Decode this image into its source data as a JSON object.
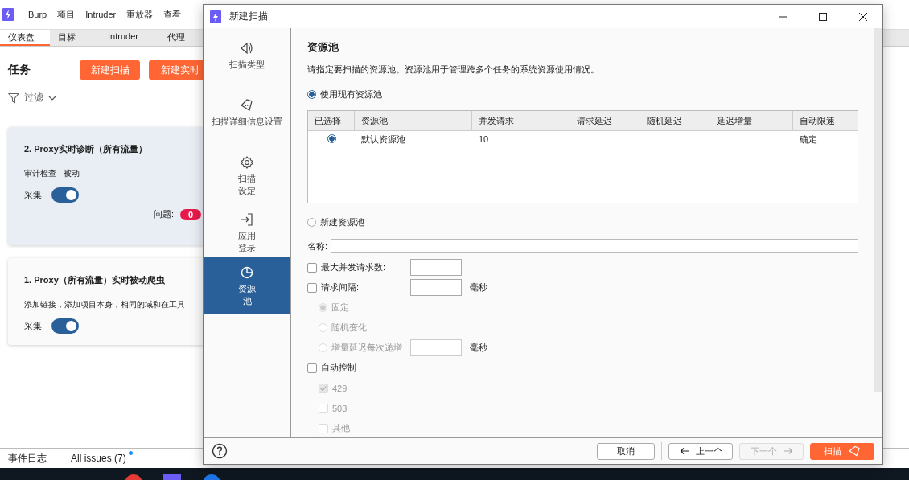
{
  "app": {
    "menu": [
      "Burp",
      "项目",
      "Intruder",
      "重放器",
      "查看"
    ],
    "tabs": [
      {
        "label": "仪表盘",
        "selected": true
      },
      {
        "label": "目标",
        "selected": false
      },
      {
        "label": "Intruder",
        "selected": false
      },
      {
        "label": "代理",
        "selected": false
      }
    ],
    "tasks_title": "任务",
    "task_buttons": [
      "新建扫描",
      "新建实时"
    ],
    "filter": "过滤",
    "tasks": [
      {
        "title": "2. Proxy实时诊断（所有流量）",
        "description": "审计检查 - 被动",
        "toggle_label": "采集",
        "on": true,
        "selected": true,
        "issues_label": "问题:",
        "issues": "0"
      },
      {
        "title": "1. Proxy（所有流量）实时被动爬虫",
        "description": "添加链接，添加项目本身，相同的域和在工具",
        "toggle_label": "采集",
        "on": true,
        "selected": false
      }
    ],
    "status_bar": [
      {
        "label": "事件日志",
        "dot": false
      },
      {
        "label": "All issues (7)",
        "dot": true
      }
    ]
  },
  "dialog": {
    "title": "新建扫描",
    "nav": [
      {
        "label": "扫描类型",
        "selected": false,
        "wrap": false
      },
      {
        "label": "扫描详细信息设置",
        "selected": false,
        "wrap": false
      },
      {
        "label": "扫描设定",
        "selected": false,
        "wrap": true
      },
      {
        "label": "应用登录",
        "selected": false,
        "wrap": true
      },
      {
        "label": "资源池",
        "selected": true,
        "wrap": true
      }
    ],
    "heading": "资源池",
    "description": "请指定要扫描的资源池。资源池用于管理跨多个任务的系统资源使用情况。",
    "use_existing": {
      "label": "使用现有资源池",
      "selected": true
    },
    "table": {
      "columns": [
        "已选择",
        "资源池",
        "并发请求",
        "请求延迟",
        "随机延迟",
        "延迟增量",
        "自动限速"
      ],
      "rows": [
        {
          "selected": true,
          "cells": [
            "",
            "默认资源池",
            "10",
            "",
            "",
            "",
            "确定"
          ]
        }
      ]
    },
    "create_new": {
      "label": "新建资源池",
      "selected": false
    },
    "name_label": "名称:",
    "options": [
      {
        "kind": "checkbox",
        "label": "最大并发请求数:",
        "checked": false,
        "disabled": false,
        "input": true
      },
      {
        "kind": "checkbox",
        "label": "请求间隔:",
        "checked": false,
        "disabled": false,
        "input": true,
        "unit": "毫秒",
        "children": [
          {
            "kind": "radio",
            "label": "固定",
            "selected": true,
            "disabled": true
          },
          {
            "kind": "radio",
            "label": "随机变化",
            "selected": false,
            "disabled": true
          },
          {
            "kind": "radio",
            "label": "增量延迟每次递增",
            "selected": false,
            "disabled": true,
            "input": true,
            "unit": "毫秒"
          }
        ]
      },
      {
        "kind": "checkbox",
        "label": "自动控制",
        "checked": false,
        "disabled": false,
        "children": [
          {
            "kind": "checkbox",
            "label": "429",
            "checked": true,
            "disabled": true
          },
          {
            "kind": "checkbox",
            "label": "503",
            "checked": false,
            "disabled": true
          },
          {
            "kind": "checkbox",
            "label": "其他",
            "checked": false,
            "disabled": true
          }
        ]
      }
    ],
    "buttons": [
      {
        "kind": "cancel",
        "label": "取消",
        "disabled": false
      },
      {
        "kind": "back",
        "label": "上一个",
        "disabled": false
      },
      {
        "kind": "next",
        "label": "下一个",
        "disabled": true
      },
      {
        "kind": "scan",
        "label": "扫描",
        "disabled": false
      }
    ]
  }
}
